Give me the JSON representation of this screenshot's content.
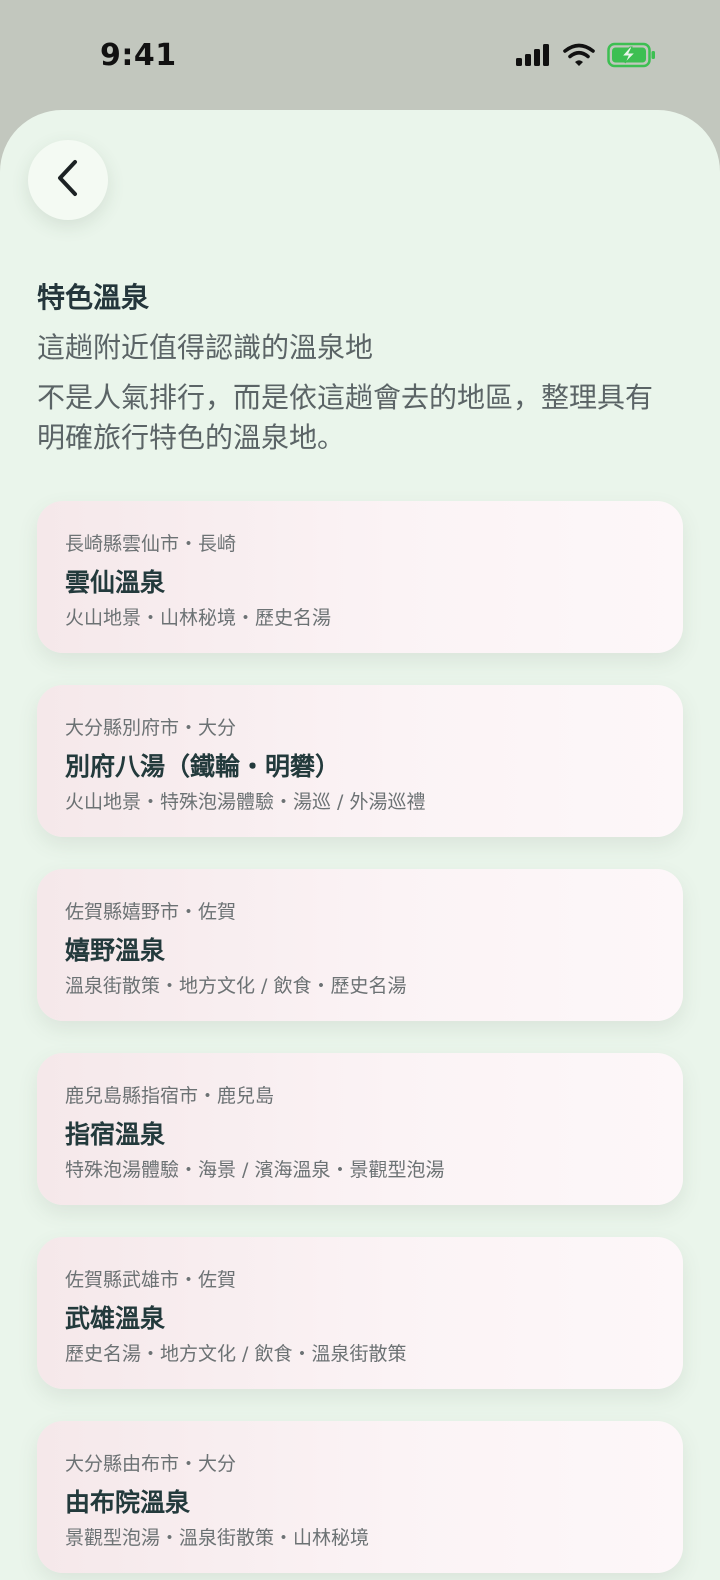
{
  "status_bar": {
    "time": "9:41"
  },
  "header": {
    "title": "特色溫泉",
    "subtitle": "這趟附近值得認識的溫泉地",
    "description": "不是人氣排行，而是依這趟會去的地區，整理具有明確旅行特色的溫泉地。"
  },
  "icons": {
    "back": "chevron-left-icon",
    "signal": "cellular-signal-icon",
    "wifi": "wifi-icon",
    "battery": "battery-charging-icon"
  },
  "colors": {
    "battery_fill": "#3dbf52",
    "sheet_background": "#eaf5eb",
    "title_text": "#24363b"
  },
  "onsen_list": [
    {
      "location": "長崎縣雲仙市・長崎",
      "name": "雲仙溫泉",
      "tags": "火山地景・山林秘境・歷史名湯"
    },
    {
      "location": "大分縣別府市・大分",
      "name": "別府八湯（鐵輪・明礬）",
      "tags": "火山地景・特殊泡湯體驗・湯巡 / 外湯巡禮"
    },
    {
      "location": "佐賀縣嬉野市・佐賀",
      "name": "嬉野溫泉",
      "tags": "溫泉街散策・地方文化 / 飲食・歷史名湯"
    },
    {
      "location": "鹿兒島縣指宿市・鹿兒島",
      "name": "指宿溫泉",
      "tags": "特殊泡湯體驗・海景 / 濱海溫泉・景觀型泡湯"
    },
    {
      "location": "佐賀縣武雄市・佐賀",
      "name": "武雄溫泉",
      "tags": "歷史名湯・地方文化 / 飲食・溫泉街散策"
    },
    {
      "location": "大分縣由布市・大分",
      "name": "由布院溫泉",
      "tags": "景觀型泡湯・溫泉街散策・山林秘境"
    }
  ]
}
